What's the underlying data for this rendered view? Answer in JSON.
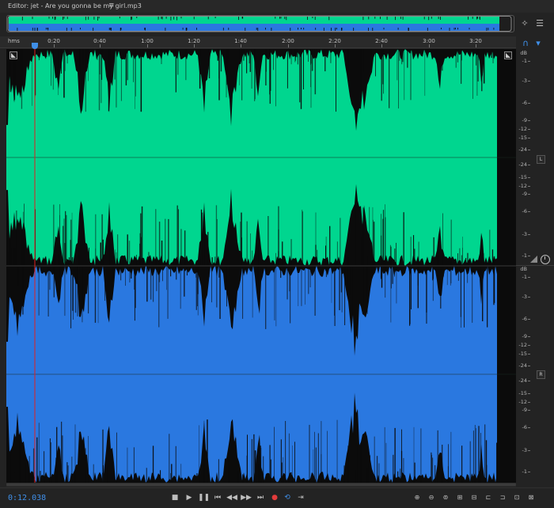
{
  "editor": {
    "title": "Editor: jet - Are you gonna be my girl.mp3",
    "menu_icon": "panel-menu-icon"
  },
  "ruler": {
    "unit": "hms",
    "labels": [
      "0:20",
      "0:40",
      "1:00",
      "1:20",
      "1:40",
      "2:00",
      "2:20",
      "2:40",
      "3:00",
      "3:20"
    ]
  },
  "channels": {
    "left": {
      "label": "L",
      "color": "#00d68f",
      "db_labels": [
        "dB",
        "-1",
        "-3",
        "-6",
        "-9",
        "-12",
        "-15",
        "-24",
        "-24",
        "-15",
        "-12",
        "-9",
        "-6",
        "-3",
        "-1"
      ]
    },
    "right": {
      "label": "R",
      "color": "#2a78e0",
      "db_labels": [
        "dB",
        "-1",
        "-3",
        "-6",
        "-9",
        "-12",
        "-15",
        "-24",
        "-24",
        "-15",
        "-12",
        "-9",
        "-6",
        "-3",
        "-1"
      ]
    }
  },
  "playhead_color": "#e02020",
  "accent_color": "#3f8fe8",
  "transport": {
    "time": "0:12.038",
    "buttons": [
      "stop-icon",
      "play-icon",
      "pause-icon",
      "go-to-start-icon",
      "rewind-icon",
      "fast-forward-icon",
      "go-to-end-icon",
      "record-icon",
      "loop-icon",
      "skip-selection-icon"
    ]
  },
  "zoom_tools": [
    "zoom-in-amplitude-icon",
    "zoom-out-amplitude-icon",
    "zoom-out-full-icon",
    "zoom-in-time-icon",
    "zoom-out-time-icon",
    "zoom-in-left-icon",
    "zoom-in-right-icon",
    "zoom-selection-icon",
    "zoom-reset-icon"
  ]
}
